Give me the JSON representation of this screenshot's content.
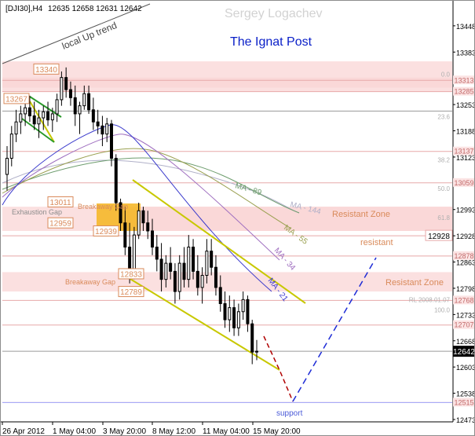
{
  "header": {
    "symbol": "[DJI30],H4",
    "ohlc": "12635 12658 12631 12642"
  },
  "watermark": "Sergey Logachev",
  "title": "The Ignat Post",
  "colors": {
    "zone": "#f9d6d6",
    "zone_line": "#e7a9a9",
    "channel": "#c8c800",
    "candle": "#000000",
    "projection_down": "#b00000",
    "projection_up": "#1d2bd6",
    "label_orange": "#d98a5a",
    "ma21": "#3a3acc",
    "ma34": "#a070c0",
    "ma55": "#9aa050",
    "ma89": "#6e9d6e",
    "ma144": "#b0b0c8",
    "gap_box": "#f5b82a"
  },
  "chart_data": {
    "type": "candlestick",
    "ylim": [
      12473,
      13510
    ],
    "y_ticks": [
      13448,
      13383,
      13318,
      13253,
      13188,
      13123,
      13058,
      12993,
      12928,
      12863,
      12798,
      12733,
      12668,
      12603,
      12538,
      12473
    ],
    "x_ticks": [
      "26 Apr 2012",
      "1 May 04:00",
      "3 May 20:00",
      "8 May 12:00",
      "11 May 04:00",
      "15 May 20:00"
    ],
    "last_price": 12642,
    "zones": [
      {
        "from": 13285,
        "to": 13320
      },
      {
        "from": 13295,
        "to": 13360
      },
      {
        "from": 12940,
        "to": 13000
      },
      {
        "from": 12790,
        "to": 12838
      }
    ],
    "levels": [
      {
        "value": 13340,
        "label": "13340",
        "side": "left"
      },
      {
        "value": 13267,
        "label": "13267",
        "side": "left"
      },
      {
        "value": 13011,
        "label": "13011",
        "side": "left"
      },
      {
        "value": 12959,
        "label": "12959",
        "side": "left"
      },
      {
        "value": 12939,
        "label": "12939",
        "side": "left"
      },
      {
        "value": 12833,
        "label": "12833",
        "side": "left"
      },
      {
        "value": 12789,
        "label": "12789",
        "side": "left"
      }
    ],
    "right_labels": [
      {
        "value": 13313,
        "label": "13313"
      },
      {
        "value": 13285,
        "label": "13285"
      },
      {
        "value": 13137,
        "label": "13137"
      },
      {
        "value": 13059,
        "label": "13059"
      },
      {
        "value": 12928,
        "label": "12928",
        "boxed": true
      },
      {
        "value": 12878,
        "label": "12878"
      },
      {
        "value": 12768,
        "label": "12768"
      },
      {
        "value": 12707,
        "label": "12707"
      },
      {
        "value": 12515,
        "label": "12515"
      }
    ],
    "fib_labels": [
      {
        "value": 13318,
        "label": "0.0"
      },
      {
        "value": 13213,
        "label": "23.6"
      },
      {
        "value": 13106,
        "label": "38.2"
      },
      {
        "value": 13035,
        "label": "50.0"
      },
      {
        "value": 12963,
        "label": "61.8"
      },
      {
        "value": 12760,
        "label": "RL 2008.01.07"
      },
      {
        "value": 12735,
        "label": "100.0"
      }
    ],
    "annotations": [
      {
        "text": "local Up trend"
      },
      {
        "text": "Exhaustion Gap"
      },
      {
        "text": "Breakaway Gap"
      },
      {
        "text": "Breakaway Gap"
      },
      {
        "text": "Resistant Zone"
      },
      {
        "text": "resistant"
      },
      {
        "text": "Resistant Zone"
      },
      {
        "text": "support"
      },
      {
        "text": "MA - 89"
      },
      {
        "text": "MA - 144"
      },
      {
        "text": "MA - 55"
      },
      {
        "text": "MA - 34"
      },
      {
        "text": "MA - 21"
      }
    ],
    "candles": [
      {
        "o": 13080,
        "h": 13150,
        "l": 13040,
        "c": 13120
      },
      {
        "o": 13120,
        "h": 13200,
        "l": 13100,
        "c": 13180
      },
      {
        "o": 13180,
        "h": 13240,
        "l": 13160,
        "c": 13210
      },
      {
        "o": 13210,
        "h": 13250,
        "l": 13180,
        "c": 13230
      },
      {
        "o": 13230,
        "h": 13270,
        "l": 13200,
        "c": 13245
      },
      {
        "o": 13245,
        "h": 13275,
        "l": 13210,
        "c": 13225
      },
      {
        "o": 13225,
        "h": 13260,
        "l": 13190,
        "c": 13205
      },
      {
        "o": 13205,
        "h": 13240,
        "l": 13170,
        "c": 13220
      },
      {
        "o": 13220,
        "h": 13250,
        "l": 13190,
        "c": 13235
      },
      {
        "o": 13235,
        "h": 13260,
        "l": 13200,
        "c": 13215
      },
      {
        "o": 13215,
        "h": 13245,
        "l": 13185,
        "c": 13230
      },
      {
        "o": 13230,
        "h": 13280,
        "l": 13210,
        "c": 13265
      },
      {
        "o": 13265,
        "h": 13335,
        "l": 13250,
        "c": 13320
      },
      {
        "o": 13320,
        "h": 13345,
        "l": 13270,
        "c": 13290
      },
      {
        "o": 13290,
        "h": 13310,
        "l": 13250,
        "c": 13270
      },
      {
        "o": 13270,
        "h": 13300,
        "l": 13200,
        "c": 13230
      },
      {
        "o": 13230,
        "h": 13260,
        "l": 13180,
        "c": 13250
      },
      {
        "o": 13250,
        "h": 13300,
        "l": 13240,
        "c": 13280
      },
      {
        "o": 13280,
        "h": 13300,
        "l": 13230,
        "c": 13240
      },
      {
        "o": 13240,
        "h": 13270,
        "l": 13190,
        "c": 13210
      },
      {
        "o": 13210,
        "h": 13240,
        "l": 13180,
        "c": 13200
      },
      {
        "o": 13200,
        "h": 13225,
        "l": 13150,
        "c": 13180
      },
      {
        "o": 13180,
        "h": 13220,
        "l": 13160,
        "c": 13205
      },
      {
        "o": 13205,
        "h": 13215,
        "l": 13100,
        "c": 13120
      },
      {
        "o": 13120,
        "h": 13130,
        "l": 12990,
        "c": 13010
      },
      {
        "o": 13010,
        "h": 13020,
        "l": 12940,
        "c": 12960
      },
      {
        "o": 12960,
        "h": 13000,
        "l": 12880,
        "c": 12900
      },
      {
        "o": 12900,
        "h": 12960,
        "l": 12810,
        "c": 12840
      },
      {
        "o": 12840,
        "h": 12950,
        "l": 12820,
        "c": 12930
      },
      {
        "o": 12930,
        "h": 13010,
        "l": 12920,
        "c": 12990
      },
      {
        "o": 12990,
        "h": 13000,
        "l": 12940,
        "c": 12960
      },
      {
        "o": 12960,
        "h": 12990,
        "l": 12920,
        "c": 12940
      },
      {
        "o": 12940,
        "h": 12970,
        "l": 12880,
        "c": 12900
      },
      {
        "o": 12900,
        "h": 12930,
        "l": 12840,
        "c": 12870
      },
      {
        "o": 12870,
        "h": 12910,
        "l": 12790,
        "c": 12820
      },
      {
        "o": 12820,
        "h": 12880,
        "l": 12800,
        "c": 12860
      },
      {
        "o": 12860,
        "h": 12900,
        "l": 12820,
        "c": 12840
      },
      {
        "o": 12840,
        "h": 12860,
        "l": 12760,
        "c": 12790
      },
      {
        "o": 12790,
        "h": 12880,
        "l": 12770,
        "c": 12860
      },
      {
        "o": 12860,
        "h": 12900,
        "l": 12800,
        "c": 12820
      },
      {
        "o": 12820,
        "h": 12930,
        "l": 12800,
        "c": 12900
      },
      {
        "o": 12900,
        "h": 12920,
        "l": 12820,
        "c": 12840
      },
      {
        "o": 12840,
        "h": 12880,
        "l": 12780,
        "c": 12800
      },
      {
        "o": 12800,
        "h": 12850,
        "l": 12760,
        "c": 12830
      },
      {
        "o": 12830,
        "h": 12920,
        "l": 12810,
        "c": 12890
      },
      {
        "o": 12890,
        "h": 12920,
        "l": 12830,
        "c": 12850
      },
      {
        "o": 12850,
        "h": 12880,
        "l": 12780,
        "c": 12800
      },
      {
        "o": 12800,
        "h": 12830,
        "l": 12740,
        "c": 12760
      },
      {
        "o": 12760,
        "h": 12790,
        "l": 12700,
        "c": 12720
      },
      {
        "o": 12720,
        "h": 12780,
        "l": 12690,
        "c": 12750
      },
      {
        "o": 12750,
        "h": 12770,
        "l": 12680,
        "c": 12700
      },
      {
        "o": 12700,
        "h": 12760,
        "l": 12680,
        "c": 12740
      },
      {
        "o": 12740,
        "h": 12790,
        "l": 12720,
        "c": 12770
      },
      {
        "o": 12770,
        "h": 12780,
        "l": 12690,
        "c": 12710
      },
      {
        "o": 12710,
        "h": 12720,
        "l": 12610,
        "c": 12640
      },
      {
        "o": 12640,
        "h": 12670,
        "l": 12620,
        "c": 12642
      }
    ]
  }
}
